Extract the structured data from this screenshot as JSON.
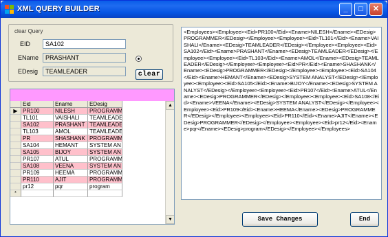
{
  "window": {
    "title": "XML QUERY BUILDER"
  },
  "title_buttons": {
    "minimize": "_",
    "maximize": "□",
    "close": "✕"
  },
  "form": {
    "group_title": "clear Query",
    "eid_label": "EID",
    "eid_value": "SA102",
    "ename_label": "EName",
    "ename_value": "PRASHANT",
    "edesig_label": "EDesig",
    "edesig_value": "TEAMLEADER",
    "clear_label": "clear"
  },
  "grid": {
    "columns": [
      "Eid",
      "Ename",
      "EDesig"
    ],
    "rows": [
      {
        "eid": "PR100",
        "ename": "NILESH",
        "edesig": "PROGRAMM",
        "style": "pink",
        "current": true
      },
      {
        "eid": "TL101",
        "ename": "VAISHALI",
        "edesig": "TEAMLEADE",
        "style": "white"
      },
      {
        "eid": "SA102",
        "ename": "PRASHANT",
        "edesig": "TEAMLEADE",
        "style": "pink"
      },
      {
        "eid": "TL103",
        "ename": "AMOL",
        "edesig": "TEAMLEADE",
        "style": "white"
      },
      {
        "eid": "PR",
        "ename": "SHASHANK",
        "edesig": "PROGRAMM",
        "style": "pink"
      },
      {
        "eid": "SA104",
        "ename": "HEMANT",
        "edesig": "SYSTEM AN",
        "style": "white"
      },
      {
        "eid": "SA105",
        "ename": "BIJOY",
        "edesig": "SYSTEM AN",
        "style": "pink"
      },
      {
        "eid": "PR107",
        "ename": "ATUL",
        "edesig": "PROGRAMM",
        "style": "white"
      },
      {
        "eid": "SA108",
        "ename": "VEENA",
        "edesig": "SYSTEM AN",
        "style": "pink"
      },
      {
        "eid": "PR109",
        "ename": "HEEMA",
        "edesig": "PROGRAMM",
        "style": "white"
      },
      {
        "eid": "PR110",
        "ename": "AJIT",
        "edesig": "PROGRAMM",
        "style": "pink"
      },
      {
        "eid": "pr12",
        "ename": "pqr",
        "edesig": "program",
        "style": "white"
      }
    ],
    "current_marker": "▶",
    "new_row_marker": "*"
  },
  "xml_output": "<Employees><Employee><Eid>PR100</Eid><Ename>NILESH</Ename><EDesig>PROGRAMMER</EDesig></Employee><Employee><Eid>TL101</Eid><Ename>VAISHALI</Ename><EDesig>TEAMLEADER</EDesig></Employee><Employee><Eid>SA102</Eid><Ename>PRASHANT</Ename><EDesig>TEAMLEADER</EDesig></Employee><Employee><Eid>TL103</Eid><Ename>AMOL</Ename><EDesig>TEAMLEADER</EDesig></Employee><Employee><Eid>PR</Eid><Ename>SHASHANK</Ename><EDesig>PROGRAMMER</EDesig></Employee><Employee><Eid>SA104</Eid><Ename>HEMANT</Ename><EDesig>SYSTEM ANALYST</EDesig></Employee><Employee><Eid>SA105</Eid><Ename>BIJOY</Ename><EDesig>SYSTEM ANALYST</EDesig></Employee><Employee><Eid>PR107</Eid><Ename>ATUL</Ename><EDesig>PROGRAMMER</EDesig></Employee><Employee><Eid>SA108</Eid><Ename>VEENA</Ename><EDesig>SYSTEM ANALYST</EDesig></Employee><Employee><Eid>PR109</Eid><Ename>HEEMA</Ename><EDesig>PROGRAMMER</EDesig></Employee><Employee><Eid>PR110</Eid><Ename>AJIT</Ename><EDesig>PROGRAMMER</EDesig></Employee><Employee><Eid>pr12</Eid><Ename>pqr</Ename><EDesig>program</EDesig></Employee></Employees>",
  "buttons": {
    "save_label": "Save Changes",
    "end_label": "End"
  },
  "colors": {
    "title_bar": "#0a5de8",
    "grid_caption": "#ff99ff",
    "row_pink": "#ffc0cb",
    "window_bg": "#ece9d8"
  }
}
